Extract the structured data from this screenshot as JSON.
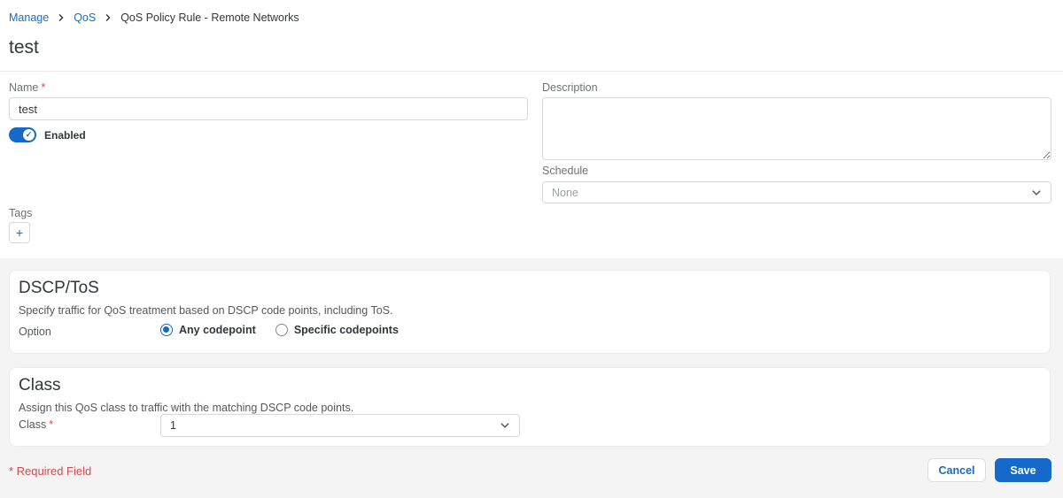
{
  "breadcrumb": {
    "items": [
      {
        "label": "Manage"
      },
      {
        "label": "QoS"
      },
      {
        "label": "QoS Policy Rule - Remote Networks"
      }
    ]
  },
  "page": {
    "title": "test"
  },
  "form": {
    "name": {
      "label": "Name",
      "required_mark": "*",
      "value": "test"
    },
    "enabled": {
      "label": "Enabled",
      "checkmark": "✓"
    },
    "description": {
      "label": "Description"
    },
    "schedule": {
      "label": "Schedule",
      "value": "None"
    },
    "tags": {
      "label": "Tags",
      "add_label": "+"
    }
  },
  "sections": {
    "dscp": {
      "title": "DSCP/ToS",
      "subtitle": "Specify traffic for QoS treatment based on DSCP code points, including ToS.",
      "option_label": "Option",
      "options": [
        {
          "label": "Any codepoint",
          "selected": true
        },
        {
          "label": "Specific codepoints",
          "selected": false
        }
      ]
    },
    "class": {
      "title": "Class",
      "subtitle": "Assign this QoS class to traffic with the matching DSCP code points.",
      "field_label": "Class",
      "required_mark": "*",
      "value": "1"
    }
  },
  "footer": {
    "required_note": "* Required Field",
    "cancel_label": "Cancel",
    "save_label": "Save"
  },
  "colors": {
    "accent_blue": "#1469C9",
    "link_blue": "#156CC9",
    "required_red": "#D04C50",
    "band_background": "#F4F4F5"
  }
}
